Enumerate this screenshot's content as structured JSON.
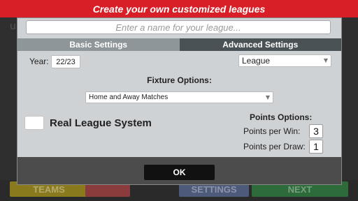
{
  "header": {
    "title": "Create your own customized leagues"
  },
  "background": {
    "corner_letter": "u",
    "teams_label": "TEAMS",
    "settings_label": "SETTINGS",
    "next_label": "NEXT"
  },
  "dialog": {
    "name_input": {
      "placeholder": "Enter a name for your league...",
      "value": ""
    },
    "tabs": [
      {
        "label": "Basic Settings",
        "active": false
      },
      {
        "label": "Advanced Settings",
        "active": true
      }
    ],
    "year": {
      "label": "Year:",
      "value": "22/23"
    },
    "competition_type": {
      "selected": "League"
    },
    "fixture": {
      "label": "Fixture Options:",
      "selected": "Home and Away Matches"
    },
    "real_league": {
      "label": "Real League System",
      "checked": false
    },
    "points": {
      "title": "Points Options:",
      "win_label": "Points per Win:",
      "win_value": "3",
      "draw_label": "Points per Draw:",
      "draw_value": "1"
    },
    "ok_label": "OK"
  },
  "colors": {
    "banner": "#d81e26",
    "dialog_bg": "#cfd2d4",
    "tab_inactive": "#8f9699",
    "tab_active": "#4b5256",
    "footer": "#4c4c4c",
    "ok_button": "#111111"
  },
  "icons": {
    "dropdown": "chevron-down-icon"
  }
}
